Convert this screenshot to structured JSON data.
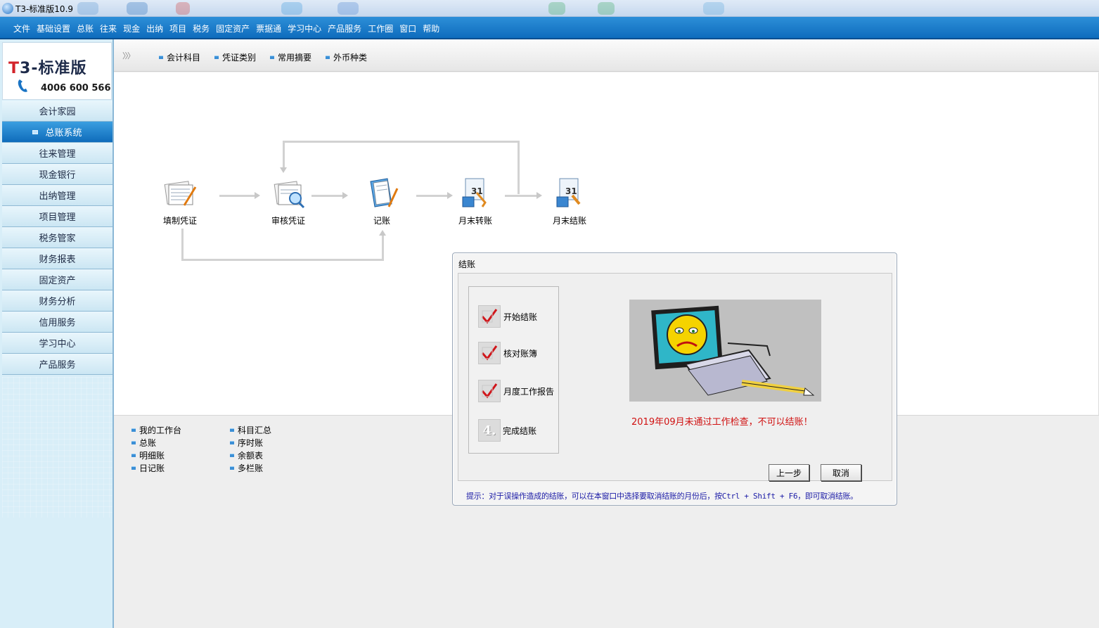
{
  "window": {
    "title": "T3-标准版10.9"
  },
  "menu": [
    "文件",
    "基础设置",
    "总账",
    "往来",
    "现金",
    "出纳",
    "项目",
    "税务",
    "固定资产",
    "票据通",
    "学习中心",
    "产品服务",
    "工作圈",
    "窗口",
    "帮助"
  ],
  "logo": {
    "brand_t": "T",
    "brand_rest": "3-标准版",
    "phone": "4006 600 566"
  },
  "sidebar": [
    {
      "label": "会计家园",
      "active": false
    },
    {
      "label": "总账系统",
      "active": true
    },
    {
      "label": "往来管理",
      "active": false
    },
    {
      "label": "现金银行",
      "active": false
    },
    {
      "label": "出纳管理",
      "active": false
    },
    {
      "label": "项目管理",
      "active": false
    },
    {
      "label": "税务管家",
      "active": false
    },
    {
      "label": "财务报表",
      "active": false
    },
    {
      "label": "固定资产",
      "active": false
    },
    {
      "label": "财务分析",
      "active": false
    },
    {
      "label": "信用服务",
      "active": false
    },
    {
      "label": "学习中心",
      "active": false
    },
    {
      "label": "产品服务",
      "active": false
    }
  ],
  "tabstrip": {
    "collapse_glyph": "〉〉〉",
    "tabs": [
      "会计科目",
      "凭证类别",
      "常用摘要",
      "外币种类"
    ]
  },
  "flow": {
    "nodes": [
      {
        "label": "填制凭证",
        "icon": "voucher-edit-icon"
      },
      {
        "label": "审核凭证",
        "icon": "voucher-audit-icon"
      },
      {
        "label": "记账",
        "icon": "post-ledger-icon"
      },
      {
        "label": "月末转账",
        "icon": "month-end-transfer-icon"
      },
      {
        "label": "月末结账",
        "icon": "month-end-close-icon"
      }
    ]
  },
  "links": {
    "col1": [
      "我的工作台",
      "总账",
      "明细账",
      "日记账"
    ],
    "col2": [
      "科目汇总",
      "序时账",
      "余额表",
      "多栏账"
    ]
  },
  "dialog": {
    "title": "结账",
    "steps": [
      {
        "label": "开始结账",
        "state": "done"
      },
      {
        "label": "核对账簿",
        "state": "done"
      },
      {
        "label": "月度工作报告",
        "state": "done"
      },
      {
        "label": "完成结账",
        "state": "pending",
        "number": "4."
      }
    ],
    "error": "2019年09月未通过工作检查，不可以结账！",
    "buttons": {
      "prev": "上一步",
      "cancel": "取消"
    },
    "hint": "提示：对于误操作造成的结账，可以在本窗口中选择要取消结账的月份后，按Ctrl + Shift + F6，即可取消结账。"
  },
  "colors": {
    "menu_bg": "#1479c6",
    "active_nav": "#1f80cc",
    "error": "#d01010",
    "hint": "#1b1ba6"
  }
}
